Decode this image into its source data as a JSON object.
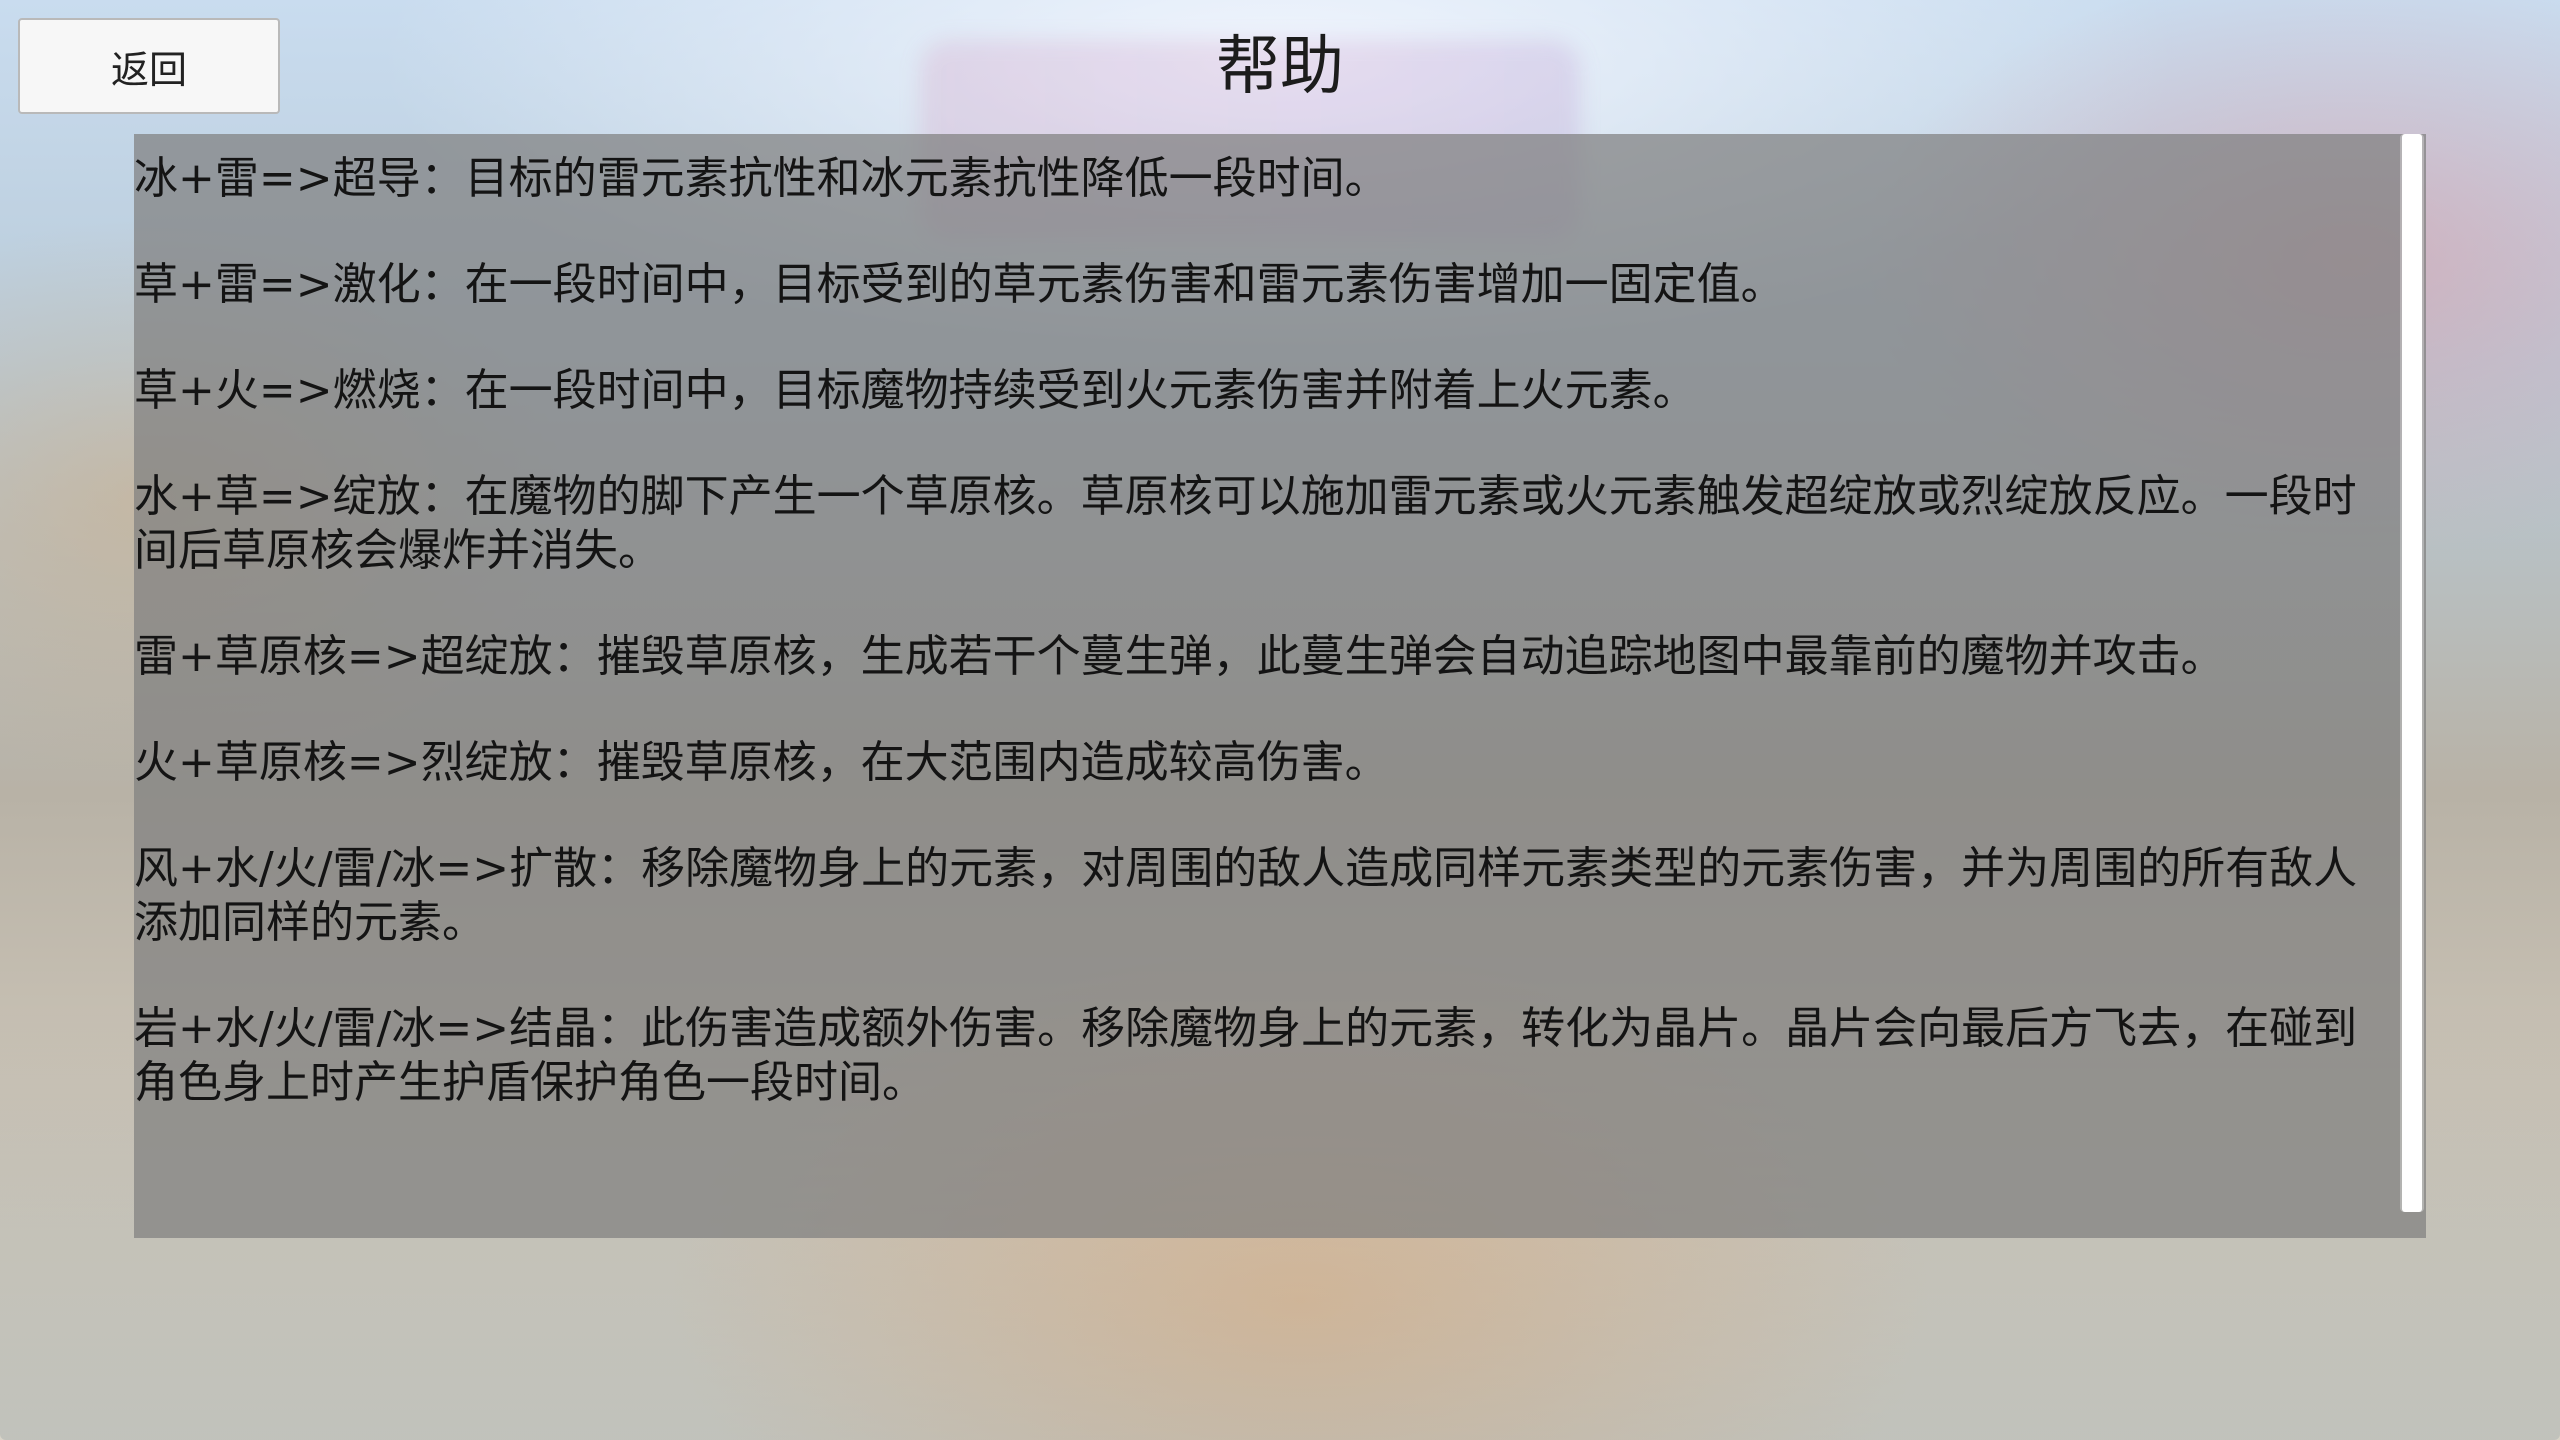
{
  "app": {
    "title": "帮助",
    "back_label": "返回"
  },
  "help": {
    "items": [
      "冰+雷=>超导：目标的雷元素抗性和冰元素抗性降低一段时间。",
      "草+雷=>激化：在一段时间中，目标受到的草元素伤害和雷元素伤害增加一固定值。",
      "草+火=>燃烧：在一段时间中，目标魔物持续受到火元素伤害并附着上火元素。",
      "水+草=>绽放：在魔物的脚下产生一个草原核。草原核可以施加雷元素或火元素触发超绽放或烈绽放反应。一段时间后草原核会爆炸并消失。",
      "雷+草原核=>超绽放：摧毁草原核，生成若干个蔓生弹，此蔓生弹会自动追踪地图中最靠前的魔物并攻击。",
      "火+草原核=>烈绽放：摧毁草原核，在大范围内造成较高伤害。",
      "风+水/火/雷/冰=>扩散：移除魔物身上的元素，对周围的敌人造成同样元素类型的元素伤害，并为周围的所有敌人添加同样的元素。",
      "岩+水/火/雷/冰=>结晶：此伤害造成额外伤害。移除魔物身上的元素，转化为晶片。晶片会向最后方飞去，在碰到角色身上时产生护盾保护角色一段时间。"
    ]
  },
  "scrollbar": {
    "position_fraction": 0.0,
    "visible_fraction": 1.0
  },
  "colors": {
    "panel_overlay": "#808080",
    "text": "#141414",
    "button_bg": "#f7f7f7"
  }
}
